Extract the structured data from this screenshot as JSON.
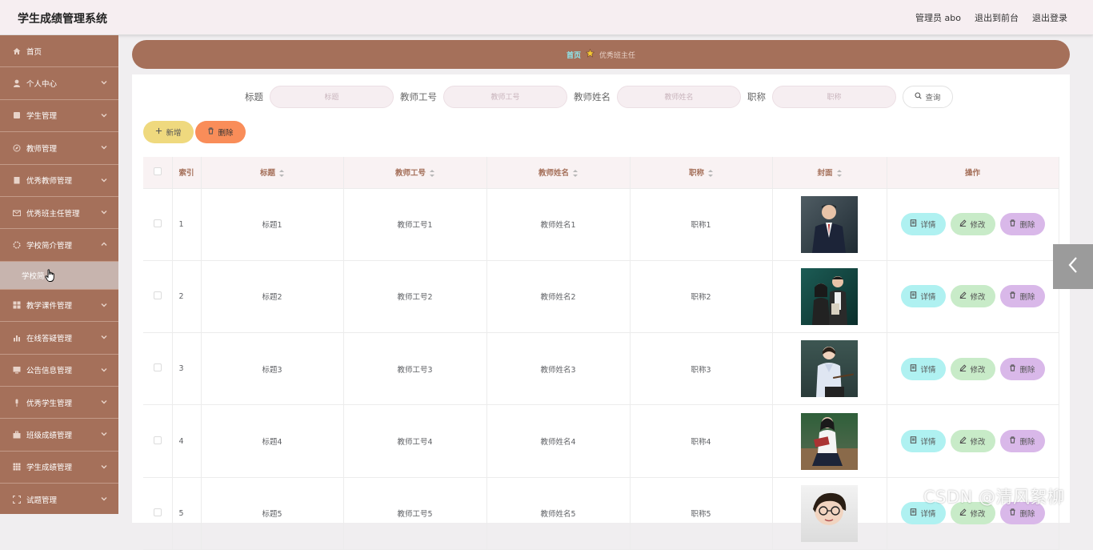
{
  "header": {
    "title": "学生成绩管理系统",
    "user": "管理员 abo",
    "to_front": "退出到前台",
    "logout": "退出登录"
  },
  "sidebar": {
    "items": [
      {
        "label": "首页",
        "icon": "home-icon"
      },
      {
        "label": "个人中心",
        "icon": "user-icon"
      },
      {
        "label": "学生管理",
        "icon": "doc-icon"
      },
      {
        "label": "教师管理",
        "icon": "compass-icon"
      },
      {
        "label": "优秀教师管理",
        "icon": "building-icon"
      },
      {
        "label": "优秀班主任管理",
        "icon": "mail-icon"
      },
      {
        "label": "学校简介管理",
        "icon": "gear-icon"
      }
    ],
    "sub_item": "学校简",
    "items_after": [
      {
        "label": "教学课件管理",
        "icon": "grid-icon"
      },
      {
        "label": "在线答疑管理",
        "icon": "chart-icon"
      },
      {
        "label": "公告信息管理",
        "icon": "monitor-icon"
      },
      {
        "label": "优秀学生管理",
        "icon": "mic-icon"
      },
      {
        "label": "班级成绩管理",
        "icon": "bag-icon"
      },
      {
        "label": "学生成绩管理",
        "icon": "table-icon"
      },
      {
        "label": "试题管理",
        "icon": "frame-icon"
      }
    ]
  },
  "breadcrumb": {
    "home": "首页",
    "current": "优秀班主任"
  },
  "search": {
    "title_label": "标题",
    "title_placeholder": "标题",
    "no_label": "教师工号",
    "no_placeholder": "教师工号",
    "name_label": "教师姓名",
    "name_placeholder": "教师姓名",
    "rank_label": "职称",
    "rank_placeholder": "职称",
    "query": "查询"
  },
  "actions": {
    "add": "新增",
    "delete": "删除"
  },
  "table": {
    "headers": {
      "index": "索引",
      "title": "标题",
      "no": "教师工号",
      "name": "教师姓名",
      "rank": "职称",
      "cover": "封面",
      "ops": "操作"
    },
    "ops": {
      "detail": "详情",
      "edit": "修改",
      "remove": "删除"
    },
    "rows": [
      {
        "index": "1",
        "title": "标题1",
        "no": "教师工号1",
        "name": "教师姓名1",
        "rank": "职称1"
      },
      {
        "index": "2",
        "title": "标题2",
        "no": "教师工号2",
        "name": "教师姓名2",
        "rank": "职称2"
      },
      {
        "index": "3",
        "title": "标题3",
        "no": "教师工号3",
        "name": "教师姓名3",
        "rank": "职称3"
      },
      {
        "index": "4",
        "title": "标题4",
        "no": "教师工号4",
        "name": "教师姓名4",
        "rank": "职称4"
      },
      {
        "index": "5",
        "title": "标题5",
        "no": "教师工号5",
        "name": "教师姓名5",
        "rank": "职称5"
      }
    ]
  },
  "watermark": "CSDN @清风絮柳"
}
